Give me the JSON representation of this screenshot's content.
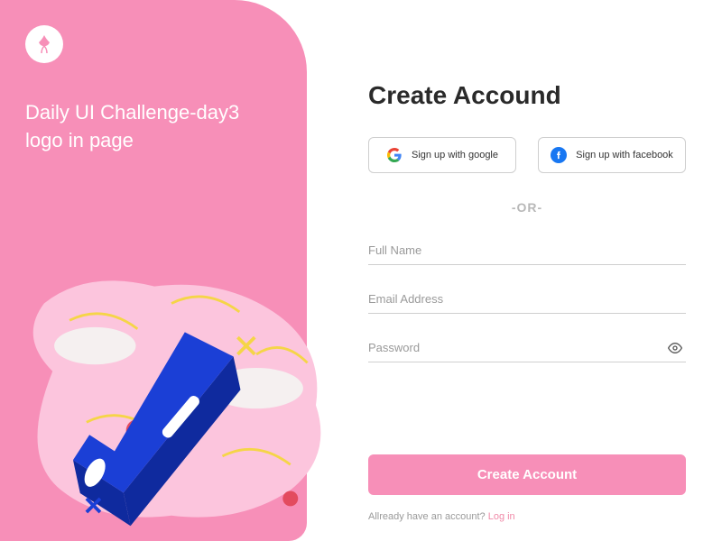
{
  "left": {
    "title_line1": "Daily UI Challenge-day3",
    "title_line2": "logo in page"
  },
  "form": {
    "heading": "Create Accound",
    "google_label": "Sign up with google",
    "facebook_label": "Sign up with facebook",
    "divider": "-OR-",
    "fullname_placeholder": "Full Name",
    "email_placeholder": "Email Address",
    "password_placeholder": "Password",
    "submit_label": "Create Account",
    "footer_text": "Allready have an account? ",
    "login_link": "Log in"
  },
  "colors": {
    "pink": "#f78fb8",
    "blue": "#1b3fd6"
  }
}
